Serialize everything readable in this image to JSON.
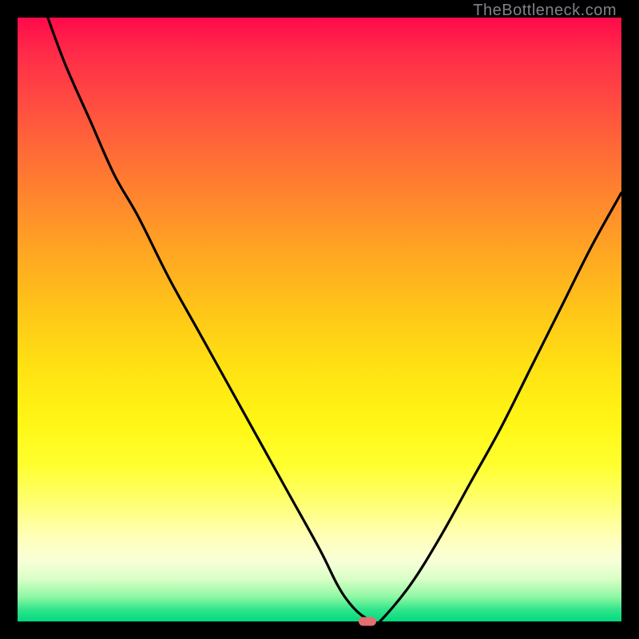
{
  "watermark": "TheBottleneck.com",
  "gradient_colors": [
    "#ff0a4a",
    "#ff2c49",
    "#ff4b41",
    "#ff6a37",
    "#ff8a2c",
    "#ffaa21",
    "#ffc718",
    "#ffe213",
    "#fff615",
    "#ffff2e",
    "#ffff6e",
    "#ffffb8",
    "#f8ffd8",
    "#d8ffc6",
    "#8cf7a3",
    "#32e68b",
    "#00d97f"
  ],
  "chart_data": {
    "type": "line",
    "title": "",
    "xlabel": "",
    "ylabel": "",
    "xlim": [
      0,
      100
    ],
    "ylim": [
      0,
      100
    ],
    "series": [
      {
        "name": "bottleneck-curve",
        "x": [
          5,
          8,
          12,
          16,
          20,
          25,
          30,
          35,
          40,
          45,
          50,
          53,
          55,
          57,
          59,
          60,
          65,
          70,
          75,
          80,
          85,
          90,
          95,
          100
        ],
        "y": [
          100,
          92,
          83,
          74,
          67,
          57,
          48,
          39,
          30,
          21,
          12,
          6,
          3,
          1,
          0,
          0,
          6,
          14,
          23,
          32,
          42,
          52,
          62,
          71
        ]
      }
    ],
    "minimum_marker": {
      "x": 58,
      "y": 0,
      "color": "#e3706e"
    },
    "grid": false,
    "legend": false
  }
}
